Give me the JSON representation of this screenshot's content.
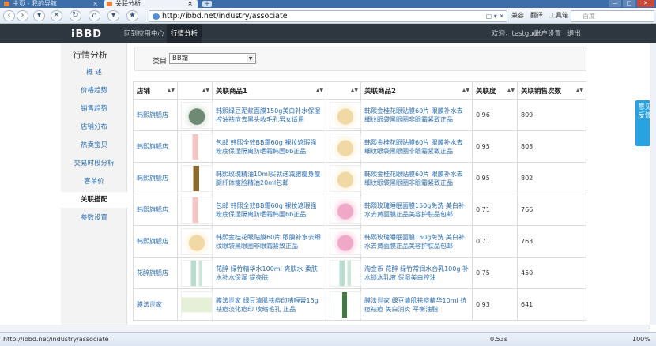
{
  "browser": {
    "tabs": [
      {
        "label": "主页 - 我的导航"
      },
      {
        "label": "关联分析"
      }
    ],
    "new_tab": "+",
    "window_buttons": [
      "—",
      "□",
      "✕"
    ],
    "url": "http://ibbd.net/industry/associate",
    "url_actions": "▢ ▾ ✕",
    "compat_label": "兼容",
    "translate_label": "翻译",
    "toolbox_label": "工具箱",
    "search_placeholder": "百度"
  },
  "header": {
    "logo": "iBBD",
    "nav": [
      {
        "label": "回到应用中心",
        "active": false
      },
      {
        "label": "行情分析",
        "active": true
      }
    ],
    "welcome": "欢迎，testguo",
    "account": "账户设置",
    "logout": "退出"
  },
  "sidebar": {
    "title": "行情分析",
    "items": [
      {
        "label": "概 述"
      },
      {
        "label": "价格趋势"
      },
      {
        "label": "销售趋势"
      },
      {
        "label": "店铺分布"
      },
      {
        "label": "热卖宝贝"
      },
      {
        "label": "交易时段分析"
      },
      {
        "label": "客单价"
      },
      {
        "label": "关联搭配"
      },
      {
        "label": "参数设置"
      }
    ]
  },
  "filter": {
    "label": "类目",
    "selected": "BB霜"
  },
  "table": {
    "headers": [
      "店铺",
      "",
      "关联商品1",
      "",
      "关联商品2",
      "关联度",
      "关联销售次数"
    ],
    "rows": [
      {
        "shop": "韩熙旗舰店",
        "img1": "mask",
        "p1": "韩熙绿豆泥浆面膜150g美白补水保湿控油祛痘去黑头收毛孔男女适用",
        "img2": "jar",
        "p2": "韩熙金桂花眼贴膜60片 眼膜补水去细纹眼袋黑眼圈非眼霜紧致正品",
        "score": "0.96",
        "count": "809"
      },
      {
        "shop": "韩熙旗舰店",
        "img1": "tube",
        "p1": "包邮 韩熙全效BB霜60g 裸妆遮瑕强粉底保湿隔离防晒霜韩国bb正品",
        "img2": "jar",
        "p2": "韩熙金桂花眼贴膜60片 眼膜补水去细纹眼袋黑眼圈非眼霜紧致正品",
        "score": "0.95",
        "count": "803"
      },
      {
        "shop": "韩熙旗舰店",
        "img1": "bottle",
        "p1": "韩熙玫瑰精油10ml买就送减肥瘦身瘦腿纤体瘦脸精油20ml包邮",
        "img2": "jar",
        "p2": "韩熙金桂花眼贴膜60片 眼膜补水去细纹眼袋黑眼圈非眼霜紧致正品",
        "score": "0.95",
        "count": "802"
      },
      {
        "shop": "韩熙旗舰店",
        "img1": "tube",
        "p1": "包邮 韩熙全效BB霜60g 裸妆遮瑕强粉底保湿隔离防晒霜韩国bb正品",
        "img2": "pinkjar",
        "p2": "韩熙玫瑰睡眠面膜150g免洗 美白补水去黄面膜正品美容护肤品包邮",
        "score": "0.71",
        "count": "766"
      },
      {
        "shop": "韩熙旗舰店",
        "img1": "jar",
        "p1": "韩熙金桂花眼贴膜60片 眼膜补水去细纹眼袋黑眼圈非眼霜紧致正品",
        "img2": "pinkjar",
        "p2": "韩熙玫瑰睡眠面膜150g免洗 美白补水去黄面膜正品美容护肤品包邮",
        "score": "0.71",
        "count": "763"
      },
      {
        "shop": "花醉旗舰店",
        "img1": "green",
        "p1": "花醉 绿竹精华水100ml 爽肤水 柔肤水补水保湿 提亮肤",
        "img2": "green",
        "p2": "淘金币 花醉 绿竹常润水合乳100g 补水锁水乳液 保湿美白控油",
        "score": "0.75",
        "count": "450"
      },
      {
        "shop": "膜法世家",
        "img1": "pack",
        "p1": "膜法世家 绿豆清肌祛痘印啫喱膏15g 祛痘淡化痘印 收缩毛孔 正品",
        "img2": "serum",
        "p2": "膜法世家 绿豆清肌祛痘精华10ml 抗痘祛痘 美白消炎 平衡油脂",
        "score": "0.93",
        "count": "641"
      }
    ]
  },
  "feedback": "意见反馈",
  "status": {
    "url": "http://ibbd.net/industry/associate",
    "time": "0.53s",
    "zoom": "100%"
  }
}
